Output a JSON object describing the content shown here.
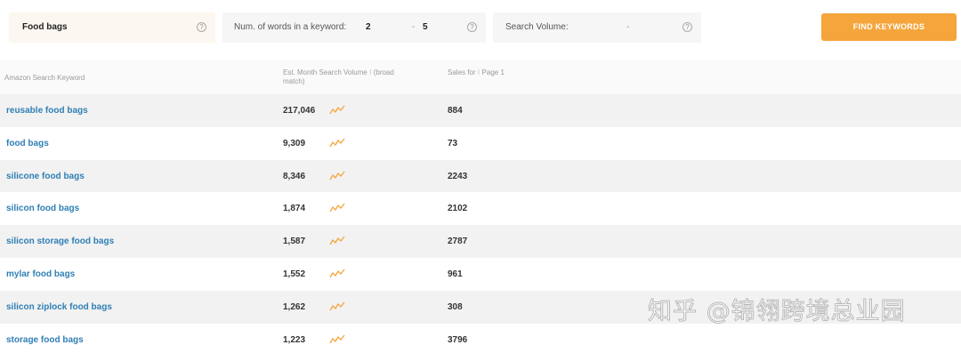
{
  "search": {
    "value": "Food bags"
  },
  "words_filter": {
    "label": "Num. of words in a keyword:",
    "min": "2",
    "separator": "-",
    "max": "5"
  },
  "volume_filter": {
    "label": "Search Volume:",
    "separator": "-"
  },
  "help_glyph": "?",
  "find_button": {
    "label": "FIND KEYWORDS"
  },
  "table": {
    "headers": {
      "keyword": "Amazon Search Keyword",
      "volume": "Est. Month Search Volume ⁝ (broad match)",
      "sales": "Sales for ⁝ Page 1"
    },
    "rows": [
      {
        "keyword": "reusable food bags",
        "volume": "217,046",
        "sales": "884"
      },
      {
        "keyword": "food bags",
        "volume": "9,309",
        "sales": "73"
      },
      {
        "keyword": "silicone food bags",
        "volume": "8,346",
        "sales": "2243"
      },
      {
        "keyword": "silicon food bags",
        "volume": "1,874",
        "sales": "2102"
      },
      {
        "keyword": "silicon storage food bags",
        "volume": "1,587",
        "sales": "2787"
      },
      {
        "keyword": "mylar food bags",
        "volume": "1,552",
        "sales": "961"
      },
      {
        "keyword": "silicon ziplock food bags",
        "volume": "1,262",
        "sales": "308"
      },
      {
        "keyword": "storage food bags",
        "volume": "1,223",
        "sales": "3796"
      }
    ]
  },
  "watermark": "知乎 @锦翎跨境总业园",
  "colors": {
    "accent": "#f5a53b",
    "link": "#2f7fb5",
    "trend": "#f5a53b"
  },
  "icons": {
    "help": "help-circle-icon",
    "trend": "trend-line-icon"
  }
}
